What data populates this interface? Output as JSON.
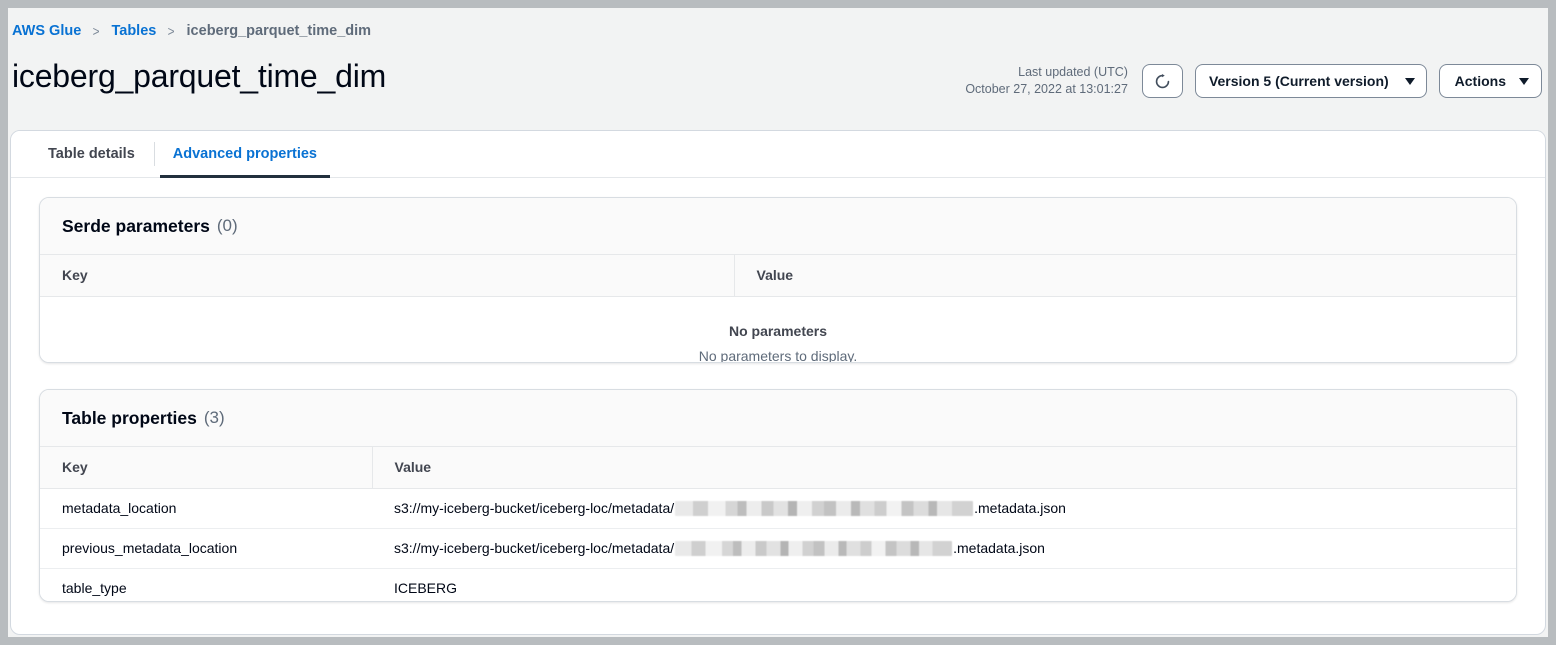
{
  "breadcrumb": {
    "items": [
      {
        "label": "AWS Glue",
        "type": "link"
      },
      {
        "label": "Tables",
        "type": "link"
      },
      {
        "label": "iceberg_parquet_time_dim",
        "type": "current"
      }
    ],
    "separator": ">"
  },
  "header": {
    "title": "iceberg_parquet_time_dim",
    "last_updated_label": "Last updated (UTC)",
    "last_updated_value": "October 27, 2022 at 13:01:27",
    "refresh_icon": "refresh-icon",
    "version_select_value": "Version 5 (Current version)",
    "actions_label": "Actions"
  },
  "tabs": [
    {
      "label": "Table details",
      "active": false
    },
    {
      "label": "Advanced properties",
      "active": true
    }
  ],
  "serde_panel": {
    "title": "Serde parameters",
    "counter": "(0)",
    "columns": [
      "Key",
      "Value"
    ],
    "empty_title": "No parameters",
    "empty_subtitle": "No parameters to display."
  },
  "table_properties_panel": {
    "title": "Table properties",
    "counter": "(3)",
    "columns": [
      "Key",
      "Value"
    ],
    "rows": [
      {
        "key": "metadata_location",
        "value_prefix": "s3://my-iceberg-bucket/iceberg-loc/metadata/",
        "value_redacted": true,
        "value_suffix": ".metadata.json"
      },
      {
        "key": "previous_metadata_location",
        "value_prefix": "s3://my-iceberg-bucket/iceberg-loc/metadata/",
        "value_redacted": true,
        "value_suffix": ".metadata.json"
      },
      {
        "key": "table_type",
        "value_prefix": "ICEBERG",
        "value_redacted": false,
        "value_suffix": ""
      }
    ]
  },
  "colors": {
    "link": "#0972d3",
    "text": "#000716",
    "muted": "#5f6b7a",
    "page_background": "#f2f3f3",
    "frame": "#b8bcbf",
    "tab_active_underline": "#22303d"
  }
}
